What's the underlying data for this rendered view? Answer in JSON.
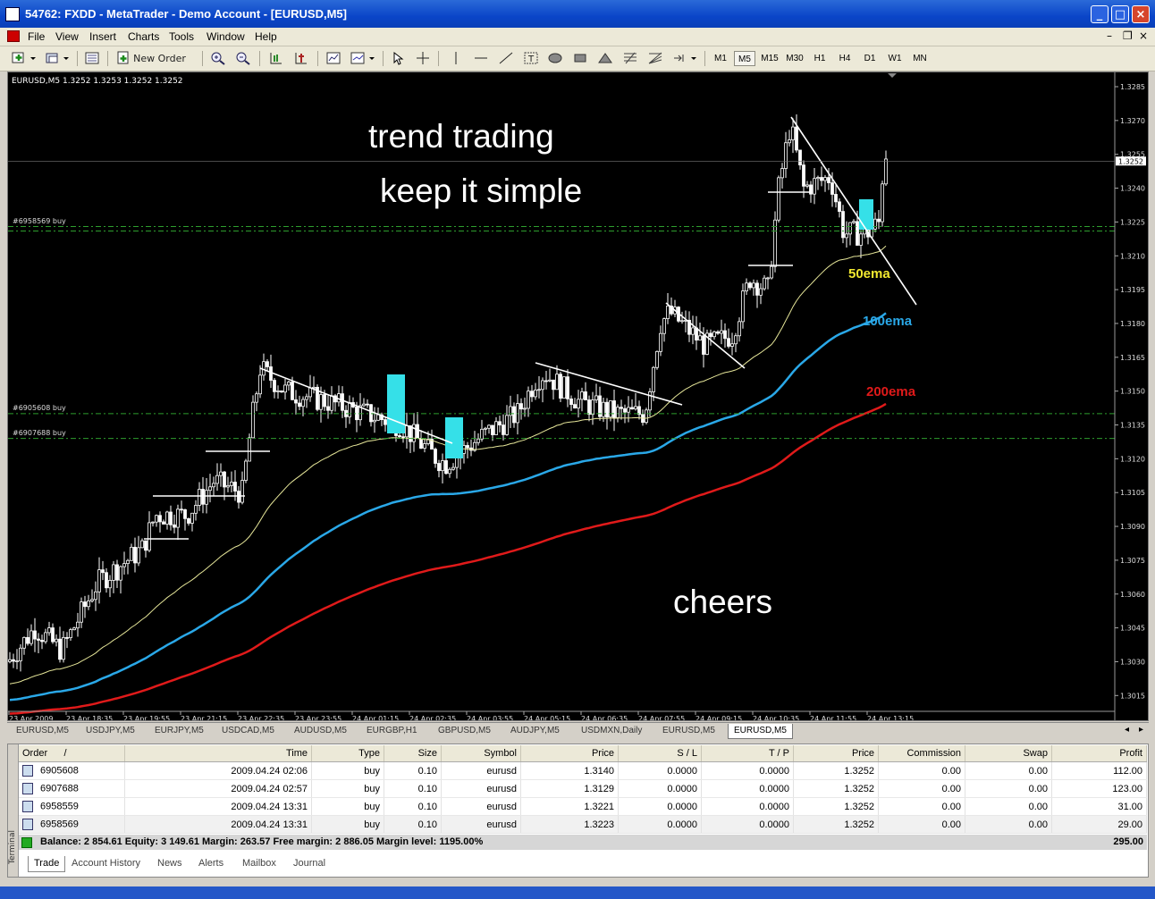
{
  "window": {
    "title": "54762: FXDD - MetaTrader - Demo Account - [EURUSD,M5]"
  },
  "menu": [
    "File",
    "View",
    "Insert",
    "Charts",
    "Tools",
    "Window",
    "Help"
  ],
  "toolbar": {
    "new_order": "New Order",
    "timeframes": [
      "M1",
      "M5",
      "M15",
      "M30",
      "H1",
      "H4",
      "D1",
      "W1",
      "MN"
    ],
    "active_timeframe": "M5"
  },
  "chart": {
    "info": "EURUSD,M5  1.3252 1.3253 1.3252 1.3252",
    "annotations": {
      "line1": "trend trading",
      "line2": "keep it simple",
      "closing": "cheers"
    },
    "ema_labels": {
      "ema50": "50ema",
      "ema100": "100ema",
      "ema200": "200ema"
    },
    "order_labels": [
      "#6958569 buy",
      "#6905608 buy",
      "#6907688 buy"
    ],
    "current_price": "1.3252",
    "price_ticks": [
      "1.3285",
      "1.3270",
      "1.3255",
      "1.3240",
      "1.3225",
      "1.3210",
      "1.3195",
      "1.3180",
      "1.3165",
      "1.3150",
      "1.3135",
      "1.3120",
      "1.3105",
      "1.3090",
      "1.3075",
      "1.3060",
      "1.3045",
      "1.3030",
      "1.3015"
    ],
    "time_ticks": [
      "23 Apr 2009",
      "23 Apr 18:35",
      "23 Apr 19:55",
      "23 Apr 21:15",
      "23 Apr 22:35",
      "23 Apr 23:55",
      "24 Apr 01:15",
      "24 Apr 02:35",
      "24 Apr 03:55",
      "24 Apr 05:15",
      "24 Apr 06:35",
      "24 Apr 07:55",
      "24 Apr 09:15",
      "24 Apr 10:35",
      "24 Apr 11:55",
      "24 Apr 13:15"
    ],
    "colors": {
      "bg": "#000000",
      "ema50": "#e6e699",
      "ema100": "#2aa8e8",
      "ema200": "#e01a1a",
      "order_line": "#2e9e2e",
      "highlight": "#35e0e8"
    }
  },
  "chart_tabs": [
    "EURUSD,M5",
    "USDJPY,M5",
    "EURJPY,M5",
    "USDCAD,M5",
    "AUDUSD,M5",
    "EURGBP,H1",
    "GBPUSD,M5",
    "AUDJPY,M5",
    "USDMXN,Daily",
    "EURUSD,M5",
    "EURUSD,M5"
  ],
  "orders": {
    "columns": [
      "Order",
      "/",
      "Time",
      "Type",
      "Size",
      "Symbol",
      "Price",
      "S / L",
      "T / P",
      "Price",
      "Commission",
      "Swap",
      "Profit"
    ],
    "rows": [
      [
        "6905608",
        "2009.04.24 02:06",
        "buy",
        "0.10",
        "eurusd",
        "1.3140",
        "0.0000",
        "0.0000",
        "1.3252",
        "0.00",
        "0.00",
        "112.00"
      ],
      [
        "6907688",
        "2009.04.24 02:57",
        "buy",
        "0.10",
        "eurusd",
        "1.3129",
        "0.0000",
        "0.0000",
        "1.3252",
        "0.00",
        "0.00",
        "123.00"
      ],
      [
        "6958559",
        "2009.04.24 13:31",
        "buy",
        "0.10",
        "eurusd",
        "1.3221",
        "0.0000",
        "0.0000",
        "1.3252",
        "0.00",
        "0.00",
        "31.00"
      ],
      [
        "6958569",
        "2009.04.24 13:31",
        "buy",
        "0.10",
        "eurusd",
        "1.3223",
        "0.0000",
        "0.0000",
        "1.3252",
        "0.00",
        "0.00",
        "29.00"
      ]
    ],
    "balance_line": "Balance: 2 854.61  Equity: 3 149.61  Margin: 263.57  Free margin: 2 886.05  Margin level: 1195.00%",
    "total_profit": "295.00"
  },
  "terminal_tabs": [
    "Trade",
    "Account History",
    "News",
    "Alerts",
    "Mailbox",
    "Journal"
  ],
  "terminal_label": "Terminal"
}
